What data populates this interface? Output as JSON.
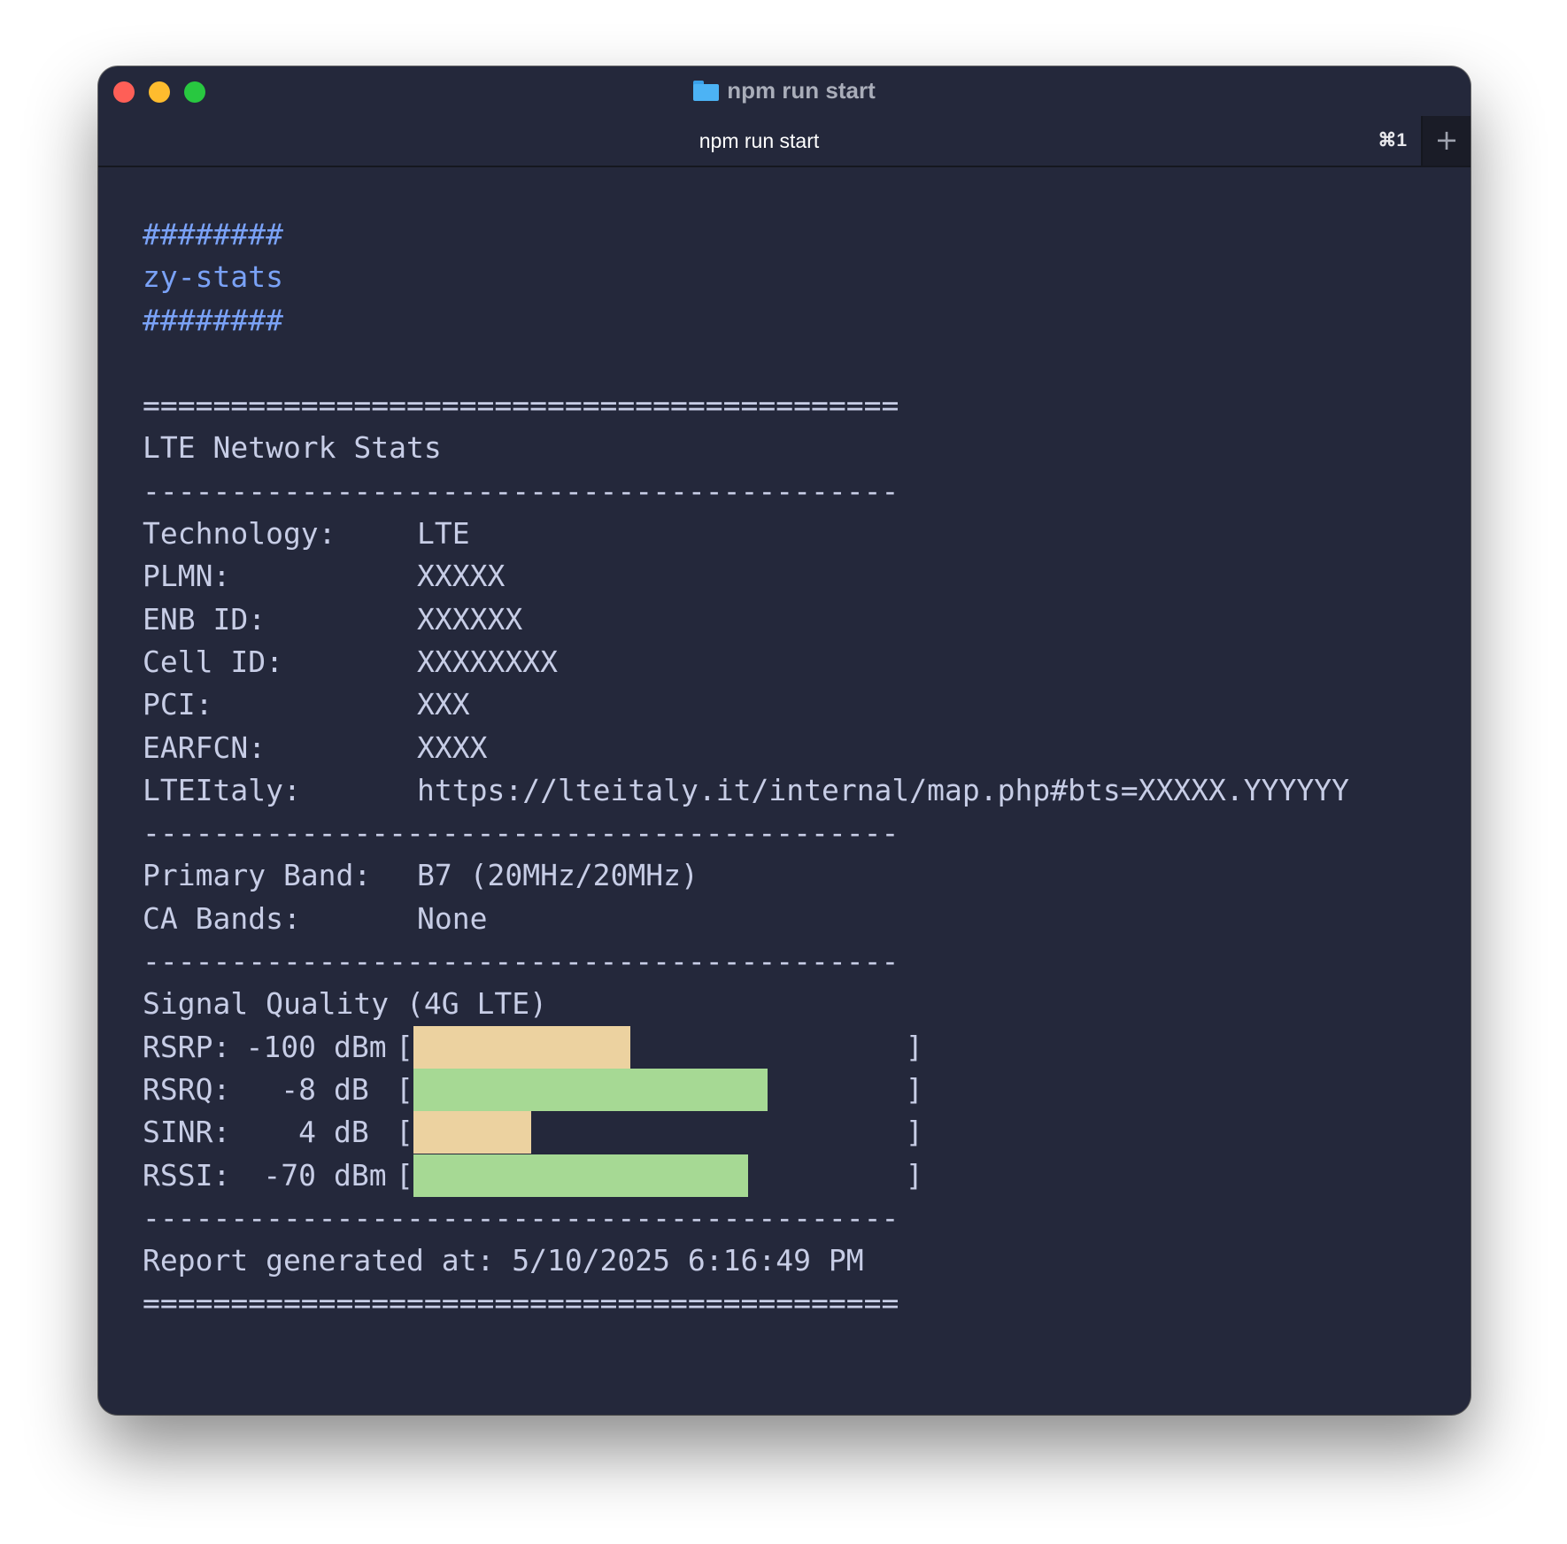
{
  "window": {
    "title": "npm run start",
    "tab_label": "npm run start",
    "tab_shortcut": "⌘1",
    "new_tab_label": "+"
  },
  "banner": {
    "hash_top": "########",
    "name": "zy-stats",
    "hash_bottom": "########"
  },
  "separators": {
    "double": "===========================================",
    "single": "-------------------------------------------"
  },
  "network": {
    "title": "LTE Network Stats",
    "rows": [
      {
        "label": "Technology:",
        "value": "LTE"
      },
      {
        "label": "PLMN:",
        "value": "XXXXX"
      },
      {
        "label": "ENB ID:",
        "value": "XXXXXX"
      },
      {
        "label": "Cell ID:",
        "value": "XXXXXXXX"
      },
      {
        "label": "PCI:",
        "value": "XXX"
      },
      {
        "label": "EARFCN:",
        "value": "XXXX"
      },
      {
        "label": "LTEItaly:",
        "value": "https://lteitaly.it/internal/map.php#bts=XXXXX.YYYYYY"
      }
    ]
  },
  "bands": {
    "rows": [
      {
        "label": "Primary Band:",
        "value": "B7 (20MHz/20MHz)"
      },
      {
        "label": "CA Bands:",
        "value": "None"
      }
    ]
  },
  "signal": {
    "title": "Signal Quality (4G LTE)",
    "bracket_open": "[",
    "bracket_close": "]",
    "rows": [
      {
        "label": "RSRP:",
        "value": "-100",
        "unit": "dBm",
        "fill": 0.44,
        "color": "#ecd2a0"
      },
      {
        "label": "RSRQ:",
        "value": "-8",
        "unit": "dB",
        "fill": 0.72,
        "color": "#a6d994"
      },
      {
        "label": "SINR:",
        "value": "4",
        "unit": "dB",
        "fill": 0.24,
        "color": "#ecd2a0"
      },
      {
        "label": "RSSI:",
        "value": "-70",
        "unit": "dBm",
        "fill": 0.68,
        "color": "#a6d994"
      }
    ]
  },
  "footer": {
    "report": "Report generated at: 5/10/2025 6:16:49 PM"
  }
}
